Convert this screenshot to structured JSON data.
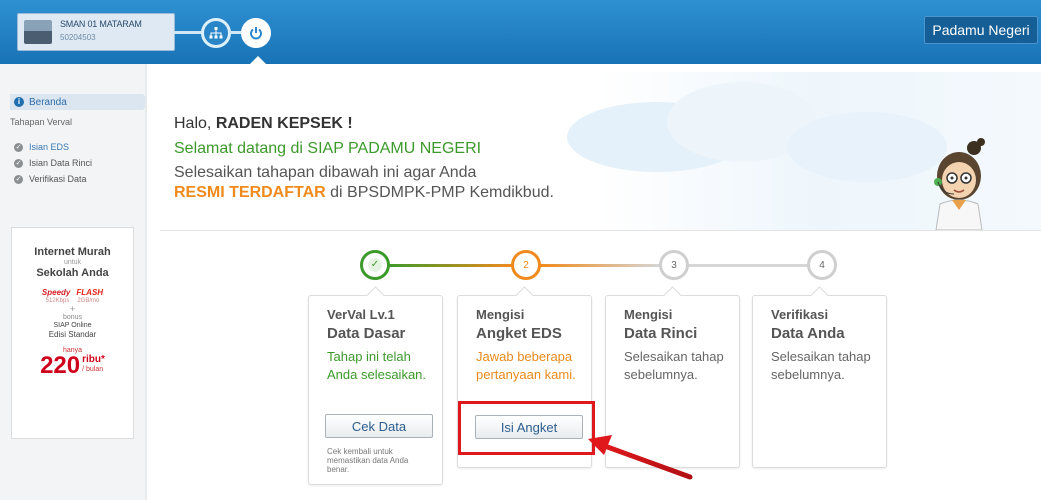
{
  "header": {
    "school_name": "SMAN 01 MATARAM",
    "school_code": "50204503",
    "brand": "Padamu Negeri"
  },
  "sidebar": {
    "home_label": "Beranda",
    "section_title": "Tahapan Verval",
    "items": [
      {
        "label": "Isian EDS"
      },
      {
        "label": "Isian Data Rinci"
      },
      {
        "label": "Verifikasi Data"
      }
    ],
    "ad": {
      "title_line1": "Internet Murah",
      "title_small": "untuk",
      "title_line2": "Sekolah Anda",
      "logo1": "Speedy",
      "logo2": "FLASH",
      "speed1": "512Kbps",
      "speed2": "2GB/mo",
      "plus": "+",
      "bonus": "bonus",
      "siap": "SIAP Online",
      "edisi": "Edisi Standar",
      "hanya": "hanya",
      "price": "220",
      "price_unit": "ribu*",
      "price_period": "/ bulan"
    }
  },
  "greeting": {
    "hello_prefix": "Halo,",
    "user_name": "RADEN KEPSEK !",
    "welcome": "Selamat datang di SIAP PADAMU NEGERI",
    "instruction": "Selesaikan tahapan dibawah ini agar Anda",
    "registered_highlight": "RESMI TERDAFTAR",
    "registered_rest": "di BPSDMPK-PMP Kemdikbud."
  },
  "steps": [
    {
      "number": "✓",
      "title1": "VerVal Lv.1",
      "title2": "Data Dasar",
      "desc": "Tahap ini telah Anda selesaikan.",
      "button": "Cek Data",
      "note": "Cek kembali untuk memastikan data Anda benar.",
      "status": "done"
    },
    {
      "number": "2",
      "title1": "Mengisi",
      "title2": "Angket EDS",
      "desc": "Jawab beberapa pertanyaan kami.",
      "button": "Isi Angket",
      "status": "current"
    },
    {
      "number": "3",
      "title1": "Mengisi",
      "title2": "Data Rinci",
      "desc": "Selesaikan tahap sebelumnya.",
      "status": "pending"
    },
    {
      "number": "4",
      "title1": "Verifikasi",
      "title2": "Data Anda",
      "desc": "Selesaikan tahap sebelumnya.",
      "status": "pending"
    }
  ],
  "colors": {
    "header_blue": "#1f7fc2",
    "done_green": "#3c9a2b",
    "current_orange": "#f08a1c",
    "pending_grey": "#bbbbbb",
    "highlight_red": "#e0181b"
  }
}
